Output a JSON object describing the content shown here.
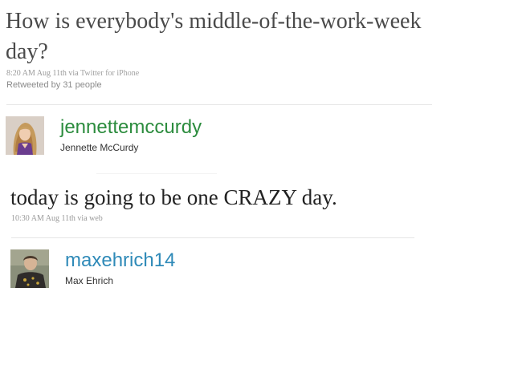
{
  "tweet1": {
    "text": "How is everybody's middle-of-the-work-week day?",
    "time": "8:20 AM Aug 11th",
    "via_prefix": "via",
    "source": "Twitter for iPhone",
    "retweeted": "Retweeted by 31 people"
  },
  "user1": {
    "username": "jennettemccurdy",
    "realname": "Jennette McCurdy",
    "avatar_icon": "profile-photo"
  },
  "tweet2": {
    "text": "today is going to be one CRAZY day.",
    "time": "10:30 AM Aug 11th",
    "via_prefix": "via",
    "source": "web"
  },
  "user2": {
    "username": "maxehrich14",
    "realname": "Max Ehrich",
    "avatar_icon": "profile-photo"
  },
  "colors": {
    "username1": "#2c8c3e",
    "username2": "#2f8ab8",
    "meta": "#999999"
  }
}
